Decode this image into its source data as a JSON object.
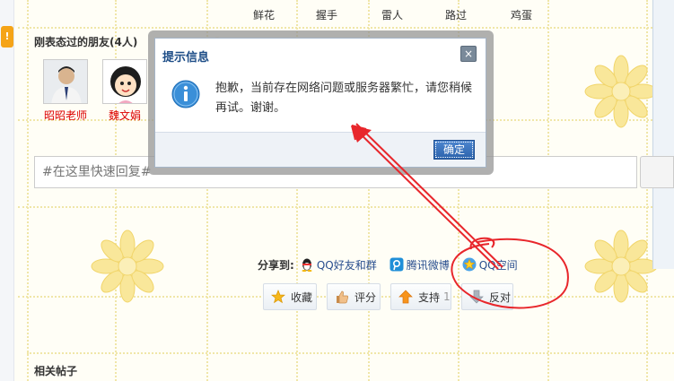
{
  "top_tags": [
    "鲜花",
    "握手",
    "雷人",
    "路过",
    "鸡蛋"
  ],
  "left_tab": {
    "glyph": "!"
  },
  "friends": {
    "title": "刚表态过的朋友(4人)",
    "items": [
      {
        "name": "昭昭老师",
        "avatar": "photo-man"
      },
      {
        "name": "魏文娟",
        "avatar": "cartoon-girl"
      }
    ]
  },
  "reply": {
    "placeholder": "#在这里快速回复#"
  },
  "share": {
    "label": "分享到:",
    "items": [
      {
        "label": "QQ好友和群",
        "icon": "qq-penguin-icon"
      },
      {
        "label": "腾讯微博",
        "icon": "tencent-weibo-icon"
      },
      {
        "label": "QQ空间",
        "icon": "qzone-star-icon"
      }
    ]
  },
  "actions": {
    "favorite": {
      "label": "收藏",
      "icon": "star-icon"
    },
    "rate": {
      "label": "评分",
      "icon": "thumb-icon"
    },
    "support": {
      "label": "支持",
      "count": "1",
      "icon": "arrow-up-icon"
    },
    "oppose": {
      "label": "反对",
      "icon": "arrow-down-icon"
    }
  },
  "related": {
    "title": "相关帖子"
  },
  "dialog": {
    "title": "提示信息",
    "close_glyph": "×",
    "message": "抱歉，当前存在网络问题或服务器繁忙，请您稍候再试。谢谢。",
    "ok_label": "确定",
    "icon": "info-icon"
  },
  "colors": {
    "dialog_title": "#1d4d87",
    "link_blue": "#2a4f8f",
    "friend_name": "#dd0000",
    "annotation_red": "#e8262b",
    "flower_fill": "#f9e79a"
  }
}
